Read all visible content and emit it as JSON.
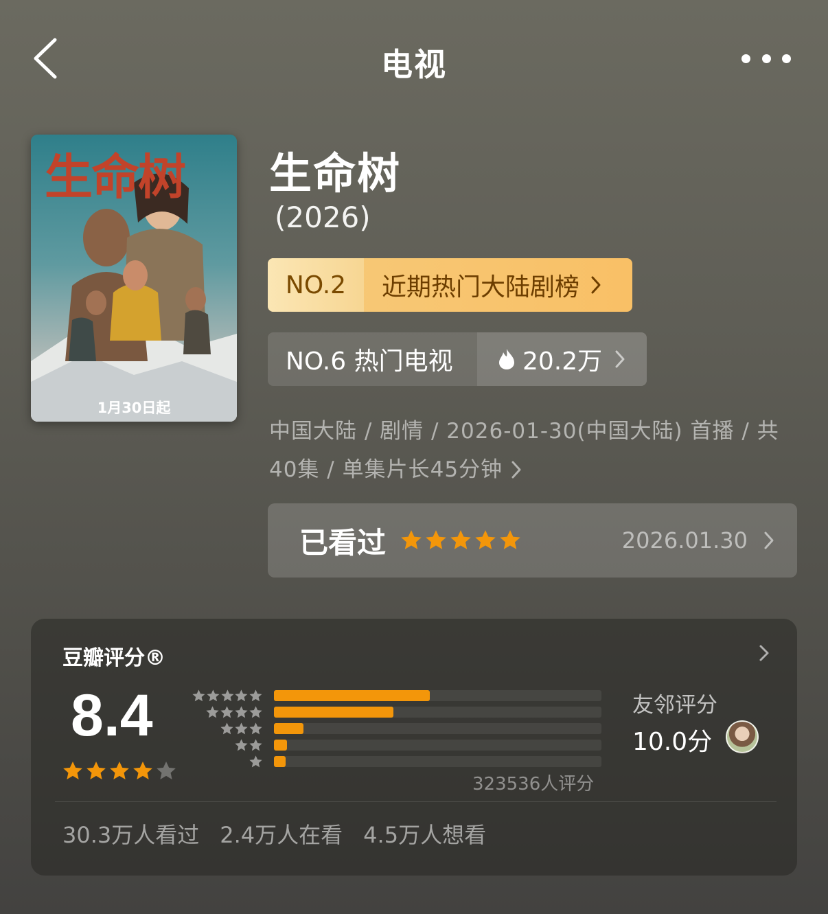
{
  "nav": {
    "title": "电视"
  },
  "poster": {
    "title_art": "生命树",
    "date_text": "1月30日起"
  },
  "show": {
    "title": "生命树",
    "year": "(2026)"
  },
  "rank_primary": {
    "number": "NO.2",
    "label": "近期热门大陆剧榜"
  },
  "rank_secondary": {
    "label": "NO.6 热门电视",
    "heat": "20.2万"
  },
  "meta": {
    "line1": "中国大陆 / 剧情 / 2026-01-30(中国大陆) 首播 / 共",
    "line2": "40集 / 单集片长45分钟"
  },
  "watched": {
    "label": "已看过",
    "stars": 5,
    "date": "2026.01.30"
  },
  "rating": {
    "title": "豆瓣评分®",
    "score": "8.4",
    "stars": 4,
    "distribution": [
      {
        "stars": 5,
        "fraction": 0.475
      },
      {
        "stars": 4,
        "fraction": 0.364
      },
      {
        "stars": 3,
        "fraction": 0.09
      },
      {
        "stars": 2,
        "fraction": 0.04
      },
      {
        "stars": 1,
        "fraction": 0.036
      }
    ],
    "count_text": "323536人评分",
    "friend_label": "友邻评分",
    "friend_score": "10.0分"
  },
  "stats": {
    "watched": "30.3万人看过",
    "watching": "2.4万人在看",
    "want": "4.5万人想看"
  },
  "colors": {
    "accent": "#f3960a",
    "rank_gold": "#f9c066"
  }
}
